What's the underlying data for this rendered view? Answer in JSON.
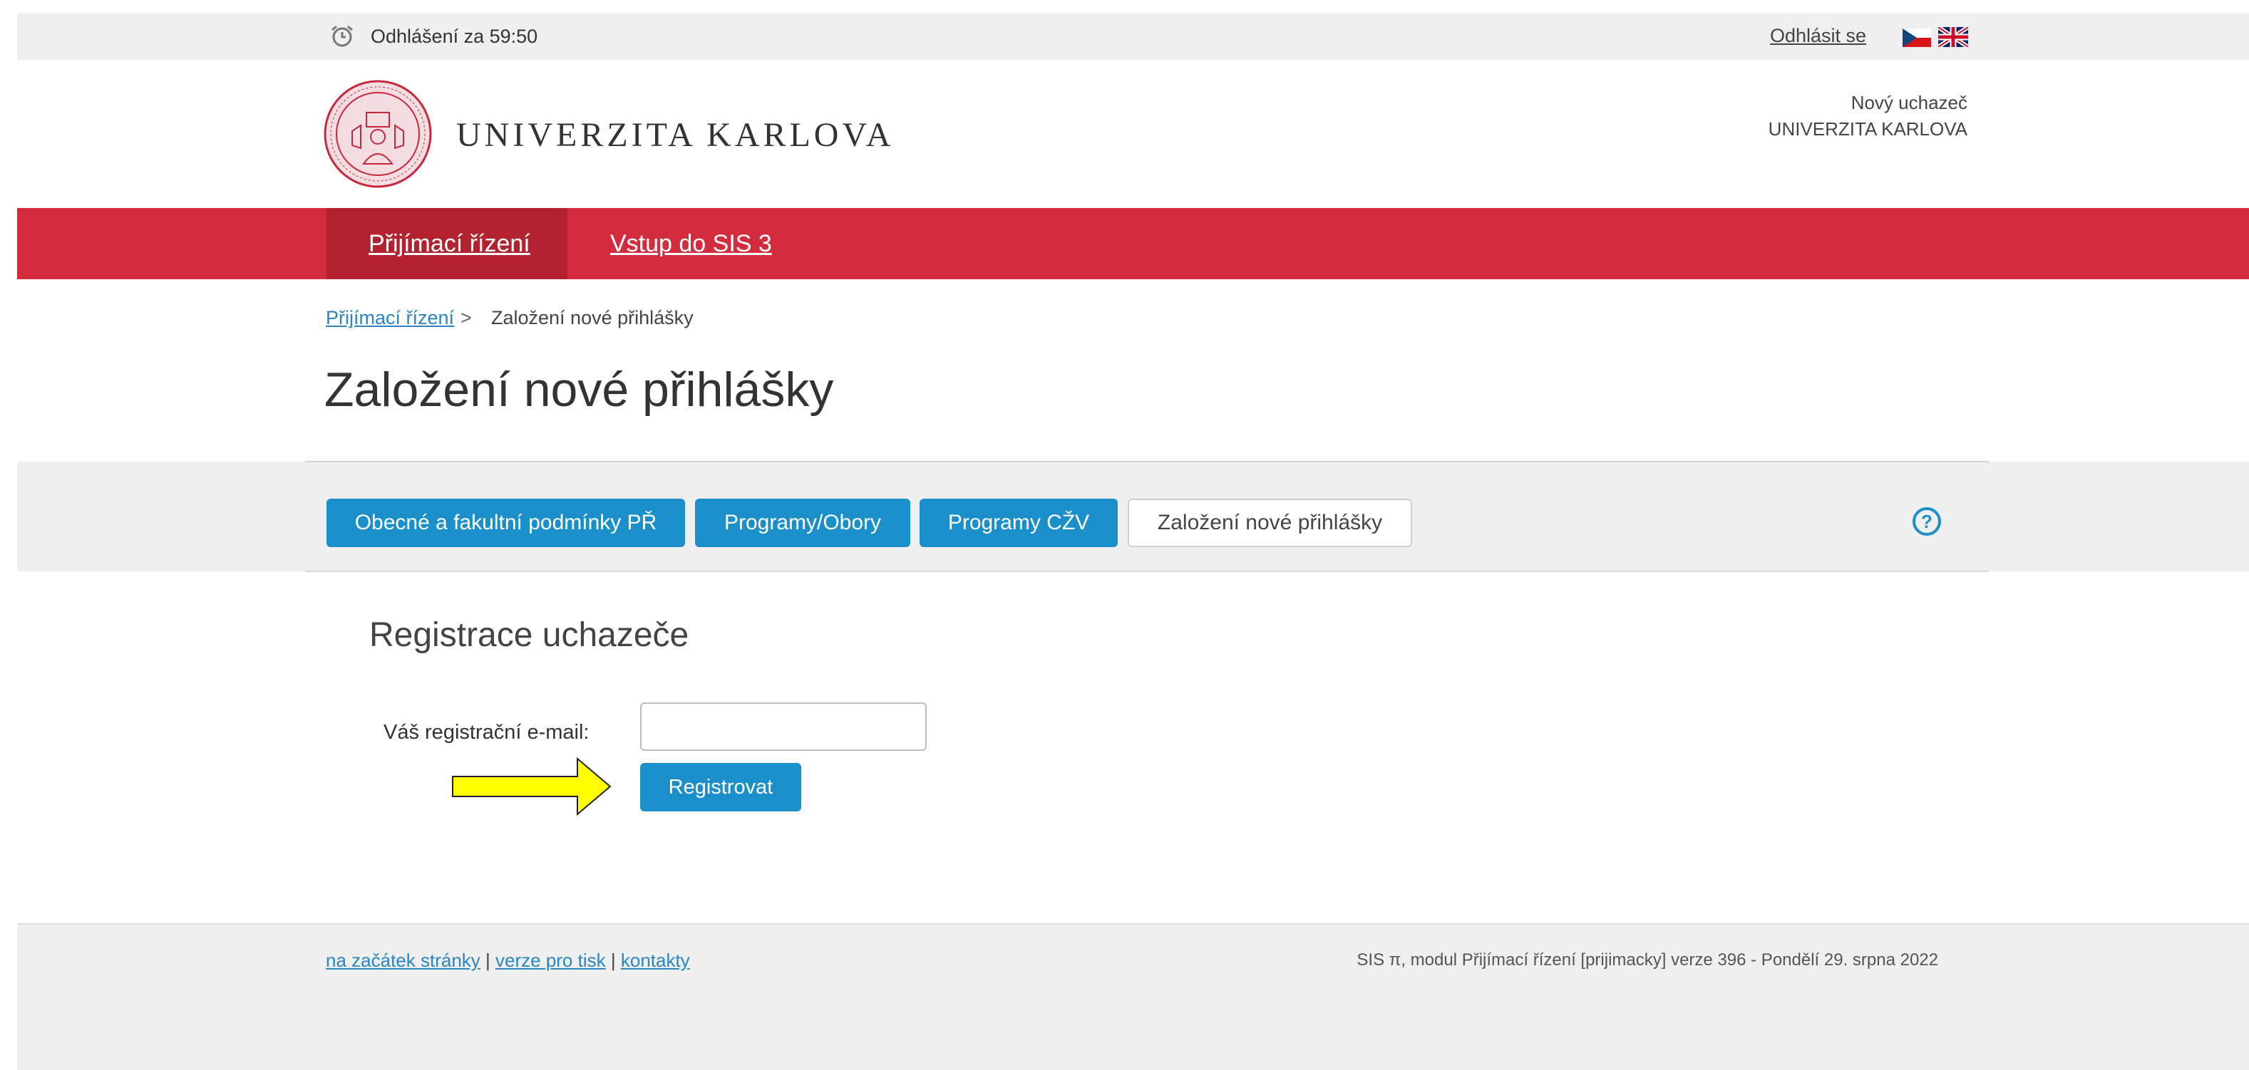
{
  "topbar": {
    "clock_icon": "alarm-clock-icon",
    "timer_text": "Odhlášení za 59:50",
    "logout_label": "Odhlásit se",
    "language_flags": [
      "czech-flag-icon",
      "uk-flag-icon"
    ]
  },
  "header": {
    "brand": "UNIVERZITA KARLOVA",
    "seal_icon": "university-seal-icon",
    "user_name": "Nový uchazeč",
    "user_org": "UNIVERZITA KARLOVA"
  },
  "nav": {
    "items": [
      {
        "label": "Přijímací řízení",
        "active": true
      },
      {
        "label": "Vstup do SIS 3",
        "active": false
      }
    ],
    "bar_color": "#d22c3e",
    "active_color": "#b2232f"
  },
  "breadcrumb": {
    "link": "Přijímací řízení",
    "separator": ">",
    "current": "Založení nové přihlášky"
  },
  "page_title": "Založení nové přihlášky",
  "tabs": [
    {
      "label": "Obecné a fakultní podmínky PŘ",
      "style": "blue"
    },
    {
      "label": "Programy/Obory",
      "style": "blue"
    },
    {
      "label": "Programy CŽV",
      "style": "blue"
    },
    {
      "label": "Založení nové přihlášky",
      "style": "white"
    }
  ],
  "help_icon": "help-circle-icon",
  "form": {
    "section_title": "Registrace uchazeče",
    "email_label": "Váš registrační e-mail:",
    "email_value": "",
    "submit_label": "Registrovat",
    "annotation": "yellow-arrow-icon"
  },
  "footer": {
    "links": [
      "na začátek stránky",
      "verze pro tisk",
      "kontakty"
    ],
    "separator": "|",
    "meta": "SIS π, modul Přijímací řízení [prijimacky] verze 396 - Pondělí 29. srpna 2022"
  },
  "colors": {
    "accent_blue": "#1a8fc9",
    "link_blue": "#2a86c0",
    "brand_red": "#d22c3e"
  }
}
